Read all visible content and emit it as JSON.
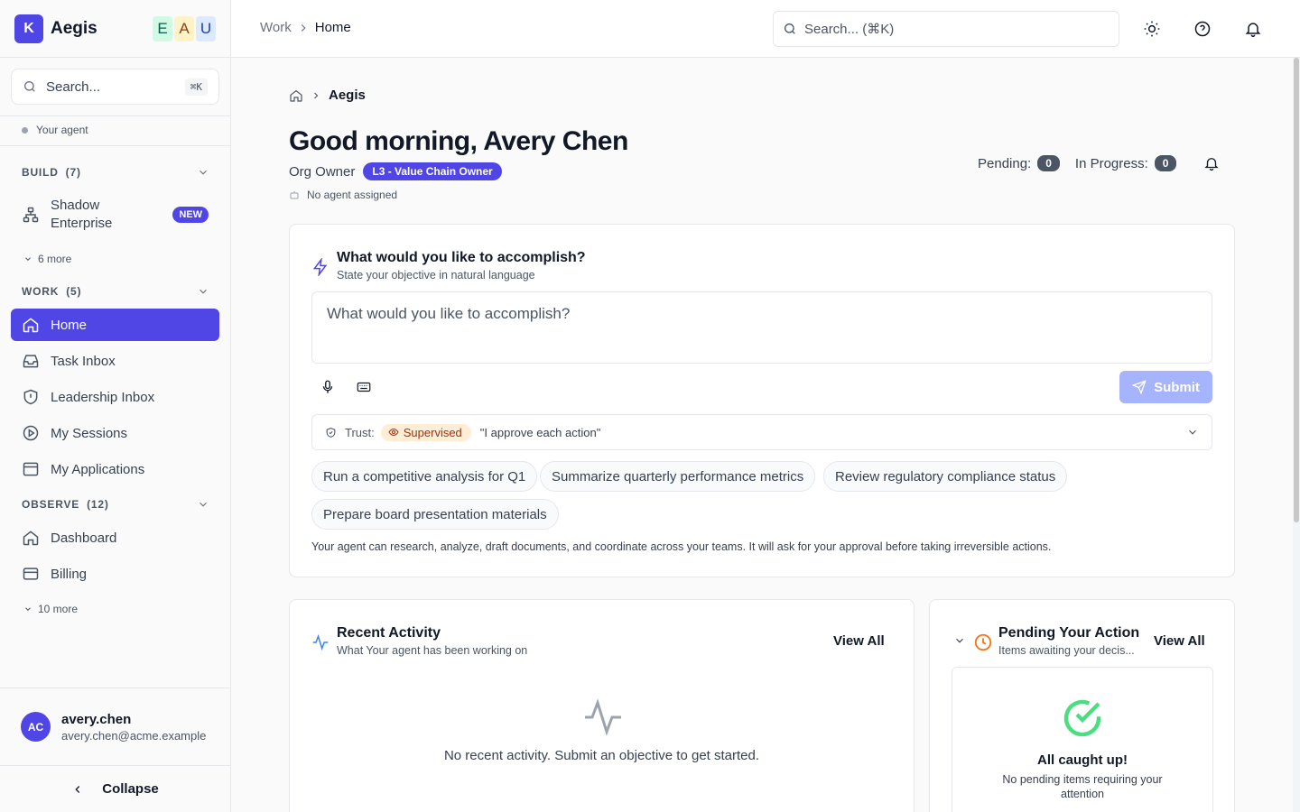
{
  "app": {
    "name": "Aegis",
    "logo_letter": "K",
    "env_chips": [
      "E",
      "A",
      "U"
    ]
  },
  "sidebar": {
    "search_placeholder": "Search...",
    "search_shortcut": "⌘K",
    "agent_label": "Your agent",
    "build": {
      "title": "BUILD",
      "count": "(7)",
      "item": {
        "label": "Shadow Enterprise",
        "badge": "NEW"
      },
      "more": "6 more"
    },
    "work": {
      "title": "WORK",
      "count": "(5)",
      "items": [
        "Home",
        "Task Inbox",
        "Leadership Inbox",
        "My Sessions",
        "My Applications"
      ]
    },
    "observe": {
      "title": "OBSERVE",
      "count": "(12)",
      "items": [
        "Dashboard",
        "Billing"
      ],
      "more": "10 more"
    },
    "user": {
      "initials": "AC",
      "name": "avery.chen",
      "email": "avery.chen@acme.example"
    },
    "collapse_label": "Collapse"
  },
  "topbar": {
    "breadcrumb": [
      "Work",
      "Home"
    ],
    "search_placeholder": "Search... (⌘K)"
  },
  "main": {
    "breadcrumb": "Aegis",
    "greeting": "Good morning, Avery Chen",
    "role": "Org Owner",
    "role_badge": "L3 - Value Chain Owner",
    "agent_status": "No agent assigned",
    "pending_label": "Pending:",
    "pending_count": "0",
    "in_progress_label": "In Progress:",
    "in_progress_count": "0",
    "objective": {
      "title": "What would you like to accomplish?",
      "subtitle": "State your objective in natural language",
      "placeholder": "What would you like to accomplish?",
      "submit_label": "Submit",
      "trust_label": "Trust:",
      "trust_level": "Supervised",
      "trust_quote": "\"I approve each action\"",
      "suggestions": [
        "Run a competitive analysis for Q1",
        "Summarize quarterly performance metrics",
        "Review regulatory compliance status",
        "Prepare board presentation materials"
      ],
      "footnote": "Your agent can research, analyze, draft documents, and coordinate across your teams. It will ask for your approval before taking irreversible actions."
    },
    "recent": {
      "title": "Recent Activity",
      "subtitle": "What Your agent has been working on",
      "view_all": "View All",
      "empty": "No recent activity. Submit an objective to get started."
    },
    "pending": {
      "title": "Pending Your Action",
      "subtitle": "Items awaiting your decis...",
      "view_all": "View All",
      "empty_title": "All caught up!",
      "empty_text": "No pending items requiring your attention"
    }
  },
  "colors": {
    "accent": "#4f46e5",
    "submit_disabled": "#a5b4fc",
    "supervised_bg": "#ffedd5",
    "success": "#4ade80",
    "warning": "#f97316"
  }
}
